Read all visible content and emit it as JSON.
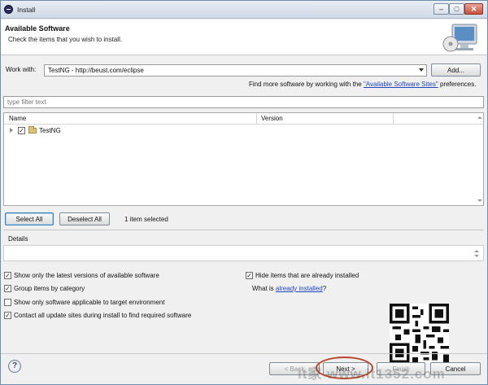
{
  "window": {
    "title": "Install"
  },
  "header": {
    "title": "Available Software",
    "description": "Check the items that you wish to install."
  },
  "work_with": {
    "label": "Work with:",
    "value": "TestNG - http://beust.com/eclipse",
    "add_label": "Add..."
  },
  "find_more": {
    "prefix": "Find more software by working with the ",
    "link": "\"Available Software Sites\"",
    "suffix": " preferences."
  },
  "filter": {
    "placeholder": "type filter text"
  },
  "table": {
    "columns": [
      "Name",
      "Version"
    ],
    "rows": [
      {
        "name": "TestNG",
        "version": "",
        "checked": true
      }
    ]
  },
  "selection": {
    "select_all": "Select All",
    "deselect_all": "Deselect All",
    "status": "1 item selected"
  },
  "details": {
    "label": "Details"
  },
  "options": {
    "latest_versions": "Show only the latest versions of available software",
    "group_by_category": "Group items by category",
    "applicable_only": "Show only software applicable to target environment",
    "contact_update_sites": "Contact all update sites during install to find required software",
    "hide_installed": "Hide items that are already installed",
    "what_is_prefix": "What is ",
    "already_installed_link": "already installed",
    "what_is_suffix": "?"
  },
  "footer": {
    "back": "< Back",
    "next": "Next >",
    "finish": "Finish",
    "cancel": "Cancel"
  },
  "watermark": "it家 www.it1352.com",
  "icons": {
    "app": "eclipse-icon",
    "header": "install-monitor-icon",
    "help": "help-icon",
    "folder": "folder-icon"
  },
  "colors": {
    "link": "#2244bb",
    "highlight_ring": "#b9452a",
    "title_bar": "#cfd9e6"
  }
}
